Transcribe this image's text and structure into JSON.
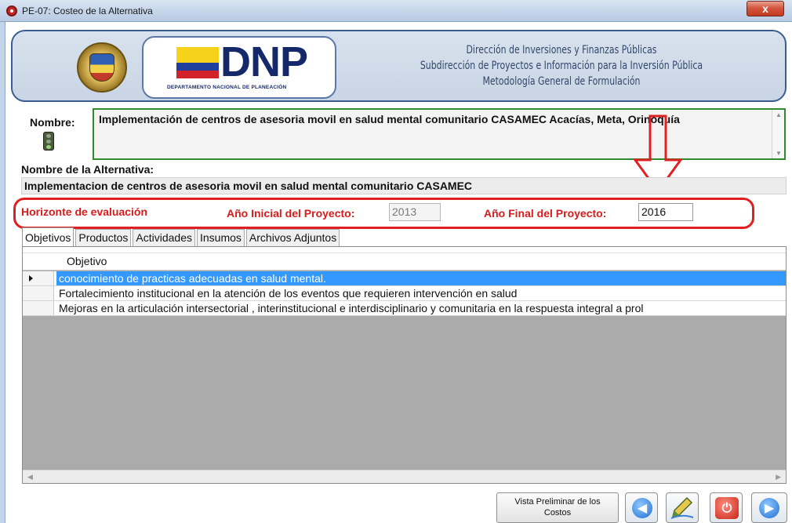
{
  "window": {
    "title": "PE-07: Costeo de la Alternativa",
    "close_label": "x"
  },
  "banner": {
    "logo_text": "DNP",
    "logo_subtext": "DEPARTAMENTO NACIONAL DE PLANEACIÓN",
    "line1": "Dirección de Inversiones y Finanzas Públicas",
    "line2": "Subdirección de Proyectos e Información para la Inversión Pública",
    "line3": "Metodología General de Formulación"
  },
  "nombre": {
    "label": "Nombre:",
    "value": "Implementación de centros de asesoria movil en salud mental comunitario CASAMEC Acacías, Meta, Orinoquía"
  },
  "alternativa": {
    "label": "Nombre de la Alternativa:",
    "value": "Implementacion de centros de asesoria movil en salud mental comunitario CASAMEC"
  },
  "horizonte": {
    "label": "Horizonte de evaluación",
    "anio_inicial_label": "Año Inicial del Proyecto:",
    "anio_inicial_value": "2013",
    "anio_final_label": "Año Final del Proyecto:",
    "anio_final_value": "2016"
  },
  "tabs": [
    {
      "label": "Objetivos",
      "active": true
    },
    {
      "label": "Productos",
      "active": false
    },
    {
      "label": "Actividades",
      "active": false
    },
    {
      "label": "Insumos",
      "active": false
    },
    {
      "label": "Archivos Adjuntos",
      "active": false
    }
  ],
  "grid": {
    "column_header": "Objetivo",
    "rows": [
      {
        "objetivo": "conocimiento de practicas adecuadas en salud mental.",
        "selected": true
      },
      {
        "objetivo": "Fortalecimiento  institucional en la atención  de  los eventos  que requieren intervención en salud",
        "selected": false
      },
      {
        "objetivo": "Mejoras en  la articulación intersectorial , interinstitucional e interdisciplinario    y comunitaria en   la respuesta integral a  prol",
        "selected": false
      }
    ]
  },
  "buttons": {
    "vista_preliminar_line1": "Vista Preliminar de los",
    "vista_preliminar_line2": "Costos",
    "back_icon": "arrow-left-icon",
    "edit_icon": "pencil-icon",
    "power_icon": "power-icon",
    "next_icon": "arrow-right-icon"
  },
  "colors": {
    "highlight_red": "#d81b1b",
    "selected_row": "#3399ff",
    "banner_border": "#3b5e92"
  }
}
